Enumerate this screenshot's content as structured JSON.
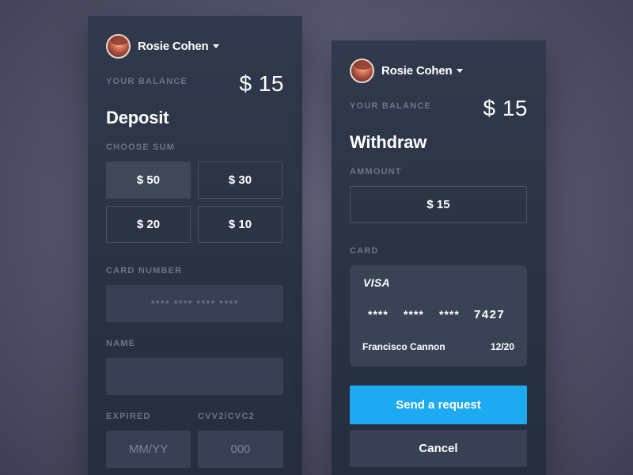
{
  "colors": {
    "background": "#5d5c75",
    "panel": "#2a3244",
    "accent": "#1eaaf1",
    "field": "#384154",
    "label": "#6c7588"
  },
  "deposit": {
    "user": {
      "name": "Rosie Cohen",
      "avatar_icon": "user-avatar"
    },
    "balance_label": "YOUR BALANCE",
    "balance_value": "$ 15",
    "title": "Deposit",
    "choose_sum_label": "CHOOSE SUM",
    "sums": [
      {
        "label": "$ 50",
        "selected": true
      },
      {
        "label": "$ 30",
        "selected": false
      },
      {
        "label": "$ 20",
        "selected": false
      },
      {
        "label": "$ 10",
        "selected": false
      }
    ],
    "card_number_label": "CARD NUMBER",
    "card_number_placeholder": "**** **** **** ****",
    "name_label": "NAME",
    "name_value": "",
    "expired_label": "EXPIRED",
    "expired_placeholder": "MM/YY",
    "cvv_label": "CVV2/CVC2",
    "cvv_placeholder": "000"
  },
  "withdraw": {
    "user": {
      "name": "Rosie Cohen",
      "avatar_icon": "user-avatar"
    },
    "balance_label": "YOUR BALANCE",
    "balance_value": "$ 15",
    "title": "Withdraw",
    "amount_label": "AMMOUNT",
    "amount_value": "$ 15",
    "card_label": "CARD",
    "card": {
      "brand": "VISA",
      "groups": [
        "****",
        "****",
        "****",
        "7427"
      ],
      "holder": "Francisco Cannon",
      "expiry": "12/20"
    },
    "submit_label": "Send a request",
    "cancel_label": "Cancel"
  }
}
